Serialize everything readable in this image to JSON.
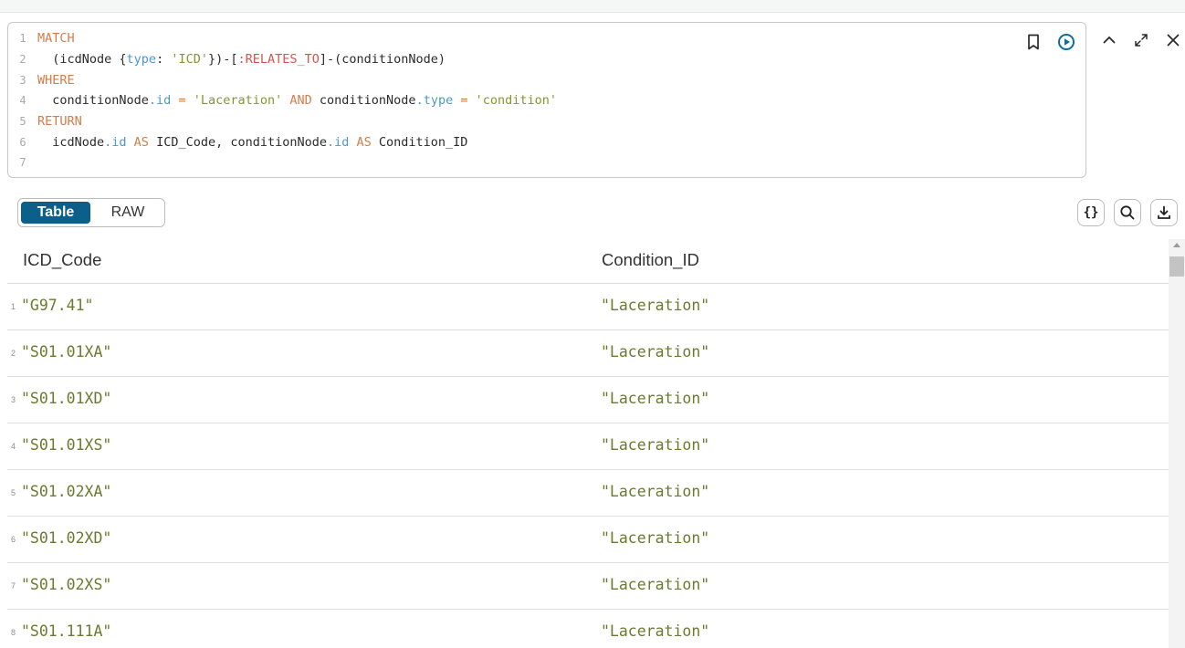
{
  "editor": {
    "lines": [
      {
        "num": "1",
        "tokens": [
          {
            "t": "MATCH",
            "k": "kw"
          }
        ]
      },
      {
        "num": "2",
        "tokens": [
          {
            "t": "  (icdNode {",
            "k": "plain"
          },
          {
            "t": "type",
            "k": "prop"
          },
          {
            "t": ": ",
            "k": "plain"
          },
          {
            "t": "'ICD'",
            "k": "str"
          },
          {
            "t": "})-[",
            "k": "plain"
          },
          {
            "t": ":RELATES_TO",
            "k": "rel"
          },
          {
            "t": "]-(conditionNode)",
            "k": "plain"
          }
        ]
      },
      {
        "num": "3",
        "tokens": [
          {
            "t": "WHERE",
            "k": "kw"
          }
        ]
      },
      {
        "num": "4",
        "tokens": [
          {
            "t": "  conditionNode",
            "k": "plain"
          },
          {
            "t": ".id",
            "k": "prop"
          },
          {
            "t": " = ",
            "k": "kw"
          },
          {
            "t": "'Laceration'",
            "k": "str"
          },
          {
            "t": " AND ",
            "k": "kw"
          },
          {
            "t": "conditionNode",
            "k": "plain"
          },
          {
            "t": ".type",
            "k": "prop"
          },
          {
            "t": " = ",
            "k": "kw"
          },
          {
            "t": "'condition'",
            "k": "str"
          }
        ]
      },
      {
        "num": "5",
        "tokens": [
          {
            "t": "RETURN",
            "k": "kw"
          }
        ]
      },
      {
        "num": "6",
        "tokens": [
          {
            "t": "  icdNode",
            "k": "plain"
          },
          {
            "t": ".id",
            "k": "prop"
          },
          {
            "t": " AS ",
            "k": "kw"
          },
          {
            "t": "ICD_Code, conditionNode",
            "k": "plain"
          },
          {
            "t": ".id",
            "k": "prop"
          },
          {
            "t": " AS ",
            "k": "kw"
          },
          {
            "t": "Condition_ID",
            "k": "plain"
          }
        ]
      },
      {
        "num": "7",
        "tokens": []
      }
    ],
    "icons": [
      "bookmark-icon",
      "run-query-icon"
    ]
  },
  "window_icons": [
    "collapse-icon",
    "fullscreen-icon",
    "close-icon"
  ],
  "view_toggle": {
    "active": "Table",
    "inactive": "RAW"
  },
  "tools": {
    "json_glyph": "{}",
    "icons": [
      "json-icon",
      "search-icon",
      "download-icon"
    ]
  },
  "colors": {
    "accent": "#0b5f8a",
    "run": "#0b6e9c",
    "string_value": "#6b7a2f"
  },
  "table": {
    "columns": [
      "ICD_Code",
      "Condition_ID"
    ],
    "rows": [
      {
        "n": "1",
        "icd": "\"G97.41\"",
        "cond": "\"Laceration\""
      },
      {
        "n": "2",
        "icd": "\"S01.01XA\"",
        "cond": "\"Laceration\""
      },
      {
        "n": "3",
        "icd": "\"S01.01XD\"",
        "cond": "\"Laceration\""
      },
      {
        "n": "4",
        "icd": "\"S01.01XS\"",
        "cond": "\"Laceration\""
      },
      {
        "n": "5",
        "icd": "\"S01.02XA\"",
        "cond": "\"Laceration\""
      },
      {
        "n": "6",
        "icd": "\"S01.02XD\"",
        "cond": "\"Laceration\""
      },
      {
        "n": "7",
        "icd": "\"S01.02XS\"",
        "cond": "\"Laceration\""
      },
      {
        "n": "8",
        "icd": "\"S01.111A\"",
        "cond": "\"Laceration\""
      }
    ]
  }
}
